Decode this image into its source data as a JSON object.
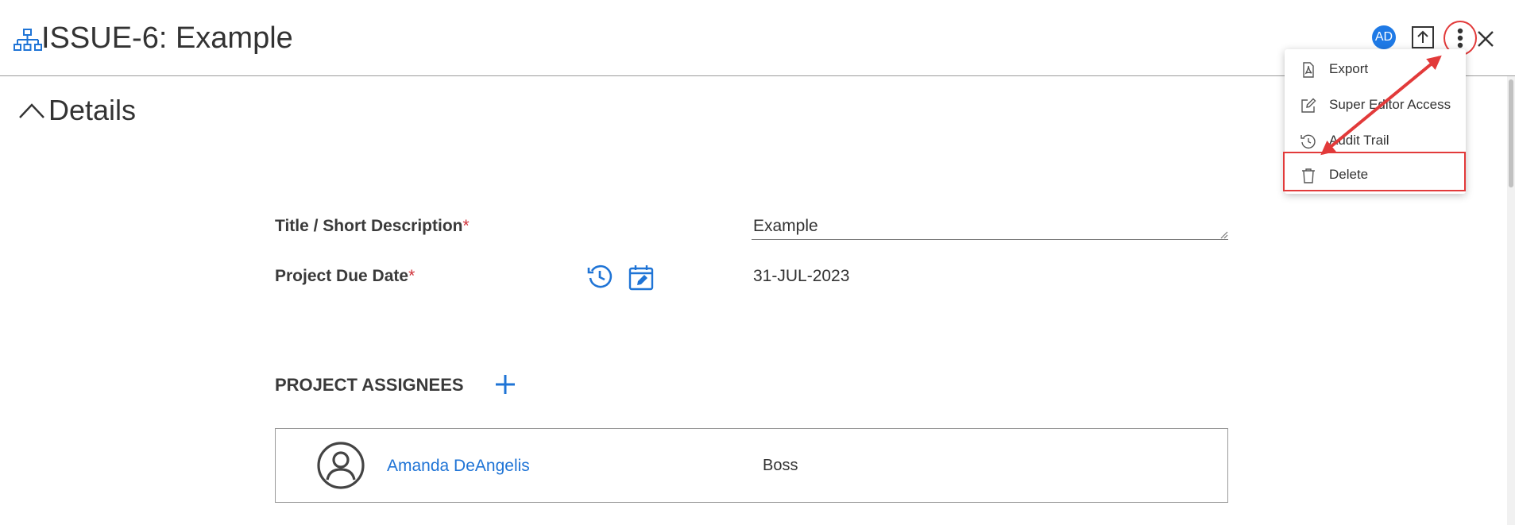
{
  "header": {
    "title": "ISSUE-6: Example",
    "avatar_initials": "AD",
    "icons": [
      "hierarchy-icon",
      "export-upload-icon",
      "more-vertical-icon",
      "close-icon"
    ]
  },
  "section": {
    "title": "Details",
    "toggle_icon": "chevron-up-icon"
  },
  "form": {
    "title_label": "Title / Short Description",
    "title_value": "Example",
    "due_label": "Project Due Date",
    "due_value": "31-JUL-2023",
    "required_mark": "*"
  },
  "assignees": {
    "title": "PROJECT ASSIGNEES",
    "items": [
      {
        "name": "Amanda DeAngelis",
        "role": "Boss"
      }
    ]
  },
  "menu": {
    "items": [
      {
        "label": "Export",
        "icon": "pdf-file-icon"
      },
      {
        "label": "Super Editor Access",
        "icon": "edit-icon"
      },
      {
        "label": "Audit Trail",
        "icon": "history-icon"
      },
      {
        "label": "Delete",
        "icon": "trash-icon"
      }
    ]
  },
  "colors": {
    "accent": "#1f7ae6",
    "annotation": "#e23a3a",
    "required": "#d0323a"
  }
}
